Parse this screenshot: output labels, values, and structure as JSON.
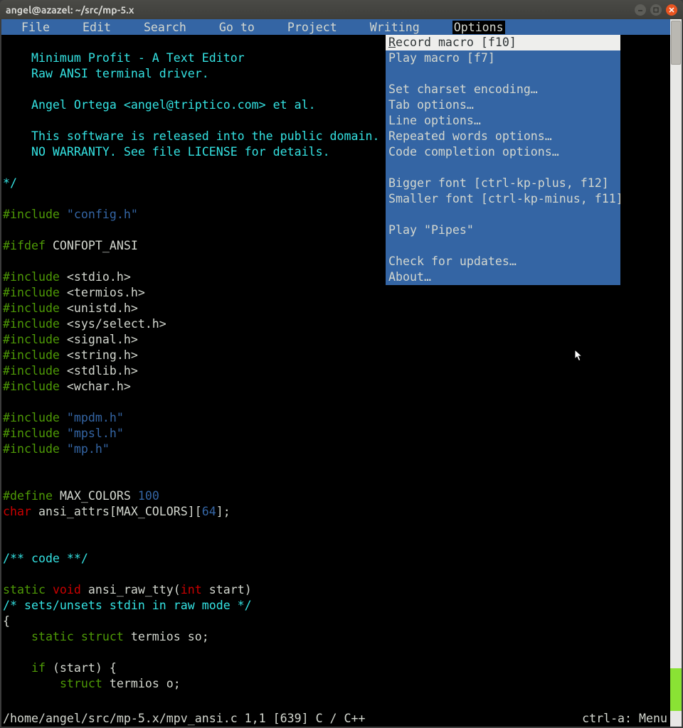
{
  "window": {
    "title": "angel@azazel: ~/src/mp-5.x"
  },
  "menubar": {
    "items": [
      "File",
      "Edit",
      "Search",
      "Go to",
      "Project",
      "Writing",
      "Options"
    ],
    "active_index": 6
  },
  "dropdown": {
    "items": [
      {
        "label": "Record macro [f10]",
        "highlight": true
      },
      {
        "label": "Play macro [f7]"
      },
      {
        "sep": true
      },
      {
        "label": "Set charset encoding…"
      },
      {
        "label": "Tab options…"
      },
      {
        "label": "Line options…"
      },
      {
        "label": "Repeated words options…"
      },
      {
        "label": "Code completion options…"
      },
      {
        "sep": true
      },
      {
        "label": "Bigger font [ctrl-kp-plus, f12]"
      },
      {
        "label": "Smaller font [ctrl-kp-minus, f11]"
      },
      {
        "sep": true
      },
      {
        "label": "Play \"Pipes\""
      },
      {
        "sep": true
      },
      {
        "label": "Check for updates…"
      },
      {
        "label": "About…"
      }
    ]
  },
  "status": {
    "left": "/home/angel/src/mp-5.x/mpv_ansi.c 1,1 [639]  C / C++",
    "right": "ctrl-a: Menu "
  },
  "code_lines": [
    [],
    [
      {
        "c": "c-comment",
        "t": "    Minimum Profit - A Text Editor"
      }
    ],
    [
      {
        "c": "c-comment",
        "t": "    Raw ANSI terminal driver."
      }
    ],
    [],
    [
      {
        "c": "c-comment",
        "t": "    Angel Ortega <angel@triptico.com> et al."
      }
    ],
    [],
    [
      {
        "c": "c-comment",
        "t": "    This software is released into the public domain."
      }
    ],
    [
      {
        "c": "c-comment",
        "t": "    NO WARRANTY. See file LICENSE for details."
      }
    ],
    [],
    [
      {
        "c": "c-comment",
        "t": "*/"
      }
    ],
    [],
    [
      {
        "c": "c-pre",
        "t": "#include "
      },
      {
        "c": "c-str",
        "t": "\"config.h\""
      }
    ],
    [],
    [
      {
        "c": "c-pre",
        "t": "#ifdef "
      },
      {
        "c": "c-ident",
        "t": "CONFOPT_ANSI"
      }
    ],
    [],
    [
      {
        "c": "c-pre",
        "t": "#include "
      },
      {
        "c": "c-ident",
        "t": "<stdio.h>"
      }
    ],
    [
      {
        "c": "c-pre",
        "t": "#include "
      },
      {
        "c": "c-ident",
        "t": "<termios.h>"
      }
    ],
    [
      {
        "c": "c-pre",
        "t": "#include "
      },
      {
        "c": "c-ident",
        "t": "<unistd.h>"
      }
    ],
    [
      {
        "c": "c-pre",
        "t": "#include "
      },
      {
        "c": "c-ident",
        "t": "<sys/select.h>"
      }
    ],
    [
      {
        "c": "c-pre",
        "t": "#include "
      },
      {
        "c": "c-ident",
        "t": "<signal.h>"
      }
    ],
    [
      {
        "c": "c-pre",
        "t": "#include "
      },
      {
        "c": "c-ident",
        "t": "<string.h>"
      }
    ],
    [
      {
        "c": "c-pre",
        "t": "#include "
      },
      {
        "c": "c-ident",
        "t": "<stdlib.h>"
      }
    ],
    [
      {
        "c": "c-pre",
        "t": "#include "
      },
      {
        "c": "c-ident",
        "t": "<wchar.h>"
      }
    ],
    [],
    [
      {
        "c": "c-pre",
        "t": "#include "
      },
      {
        "c": "c-str",
        "t": "\"mpdm.h\""
      }
    ],
    [
      {
        "c": "c-pre",
        "t": "#include "
      },
      {
        "c": "c-str",
        "t": "\"mpsl.h\""
      }
    ],
    [
      {
        "c": "c-pre",
        "t": "#include "
      },
      {
        "c": "c-str",
        "t": "\"mp.h\""
      }
    ],
    [],
    [],
    [
      {
        "c": "c-pre",
        "t": "#define "
      },
      {
        "c": "c-ident",
        "t": "MAX_COLORS "
      },
      {
        "c": "c-num",
        "t": "100"
      }
    ],
    [
      {
        "c": "c-type",
        "t": "char"
      },
      {
        "c": "c-ident",
        "t": " ansi_attrs[MAX_COLORS]["
      },
      {
        "c": "c-num",
        "t": "64"
      },
      {
        "c": "c-ident",
        "t": "];"
      }
    ],
    [],
    [],
    [
      {
        "c": "c-comment",
        "t": "/** code **/"
      }
    ],
    [],
    [
      {
        "c": "c-key",
        "t": "static "
      },
      {
        "c": "c-type",
        "t": "void"
      },
      {
        "c": "c-ident",
        "t": " ansi_raw_tty("
      },
      {
        "c": "c-type",
        "t": "int"
      },
      {
        "c": "c-ident",
        "t": " start)"
      }
    ],
    [
      {
        "c": "c-comment",
        "t": "/* sets/unsets stdin in raw mode */"
      }
    ],
    [
      {
        "c": "c-ident",
        "t": "{"
      }
    ],
    [
      {
        "c": "c-ident",
        "t": "    "
      },
      {
        "c": "c-key",
        "t": "static struct"
      },
      {
        "c": "c-ident",
        "t": " termios so;"
      }
    ],
    [],
    [
      {
        "c": "c-ident",
        "t": "    "
      },
      {
        "c": "c-key",
        "t": "if"
      },
      {
        "c": "c-ident",
        "t": " (start) {"
      }
    ],
    [
      {
        "c": "c-ident",
        "t": "        "
      },
      {
        "c": "c-key",
        "t": "struct"
      },
      {
        "c": "c-ident",
        "t": " termios o;"
      }
    ]
  ]
}
